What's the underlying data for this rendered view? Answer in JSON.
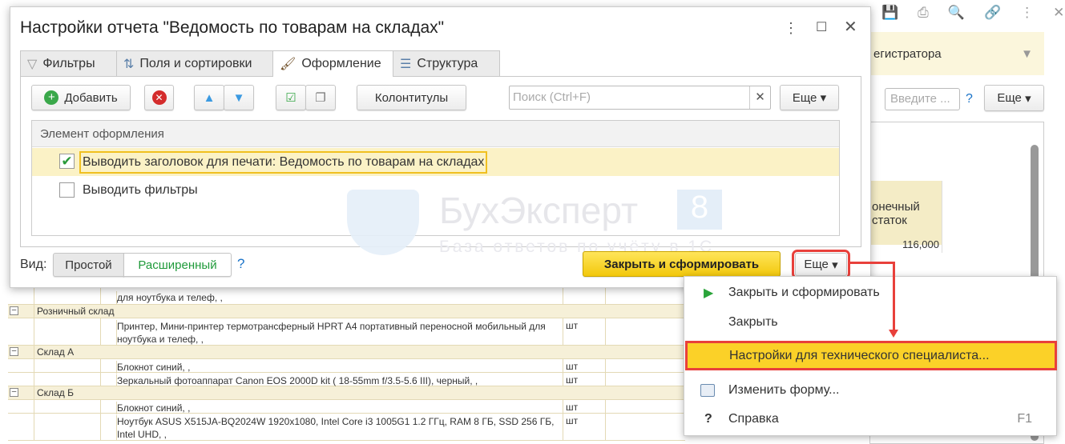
{
  "background": {
    "filter_text": "егистратора",
    "search_placeholder": "Введите ...",
    "help": "?",
    "more": "Еще",
    "header_line1": "онечный",
    "header_line2": "статок",
    "value": "116,000"
  },
  "dialog": {
    "title": "Настройки отчета \"Ведомость по товарам на складах\"",
    "tabs": [
      {
        "label": "Фильтры"
      },
      {
        "label": "Поля и сортировки"
      },
      {
        "label": "Оформление"
      },
      {
        "label": "Структура"
      }
    ],
    "toolbar": {
      "add": "Добавить",
      "headers": "Колонтитулы",
      "search_placeholder": "Поиск (Ctrl+F)",
      "more": "Еще"
    },
    "grid": {
      "header": "Элемент оформления",
      "rows": [
        {
          "label": "Выводить заголовок для печати: Ведомость по товарам на складах",
          "checked": true
        },
        {
          "label": "Выводить фильтры",
          "checked": false
        }
      ]
    },
    "footer": {
      "view_label": "Вид:",
      "simple": "Простой",
      "extended": "Расширенный",
      "help": "?",
      "close_generate": "Закрыть и сформировать",
      "more": "Еще"
    }
  },
  "watermark": {
    "brand": "БухЭксперт",
    "badge": "8",
    "tagline": "База ответов по учёту в 1С"
  },
  "report": {
    "rows": [
      {
        "type": "item",
        "name": "для ноутбука и телеф, ,",
        "unit": ""
      },
      {
        "type": "group",
        "name": "Розничный склад"
      },
      {
        "type": "item",
        "name": "Принтер, Мини-принтер термотрансферный HPRT A4 портативный переносной мобильный для ноутбука и телеф, ,",
        "unit": "шт"
      },
      {
        "type": "group",
        "name": "Склад А"
      },
      {
        "type": "item",
        "name": "Блокнот синий, ,",
        "unit": "шт"
      },
      {
        "type": "item",
        "name": "Зеркальный фотоаппарат Canon EOS 2000D kit ( 18-55mm f/3.5-5.6 III), черный, ,",
        "unit": "шт"
      },
      {
        "type": "group",
        "name": "Склад Б"
      },
      {
        "type": "item",
        "name": "Блокнот синий, ,",
        "unit": "шт"
      },
      {
        "type": "item",
        "name": "Ноутбук ASUS X515JA-BQ2024W 1920x1080, Intel Core i3 1005G1 1.2 ГГц, RAM 8 ГБ, SSD 256 ГБ, Intel UHD, ,",
        "unit": "шт"
      }
    ]
  },
  "menu": {
    "items": [
      {
        "label": "Закрыть и сформировать",
        "icon": "play-icon"
      },
      {
        "label": "Закрыть"
      },
      {
        "label": "Настройки для технического специалиста...",
        "highlighted": true
      },
      {
        "label": "Изменить форму...",
        "icon": "form-icon"
      },
      {
        "label": "Справка",
        "icon": "help-icon",
        "shortcut": "F1"
      }
    ]
  },
  "colors": {
    "highlight": "#fbd128",
    "accent_red": "#e8403b",
    "row_selected": "#fbf2c6",
    "group_row": "#f6f0d8"
  }
}
